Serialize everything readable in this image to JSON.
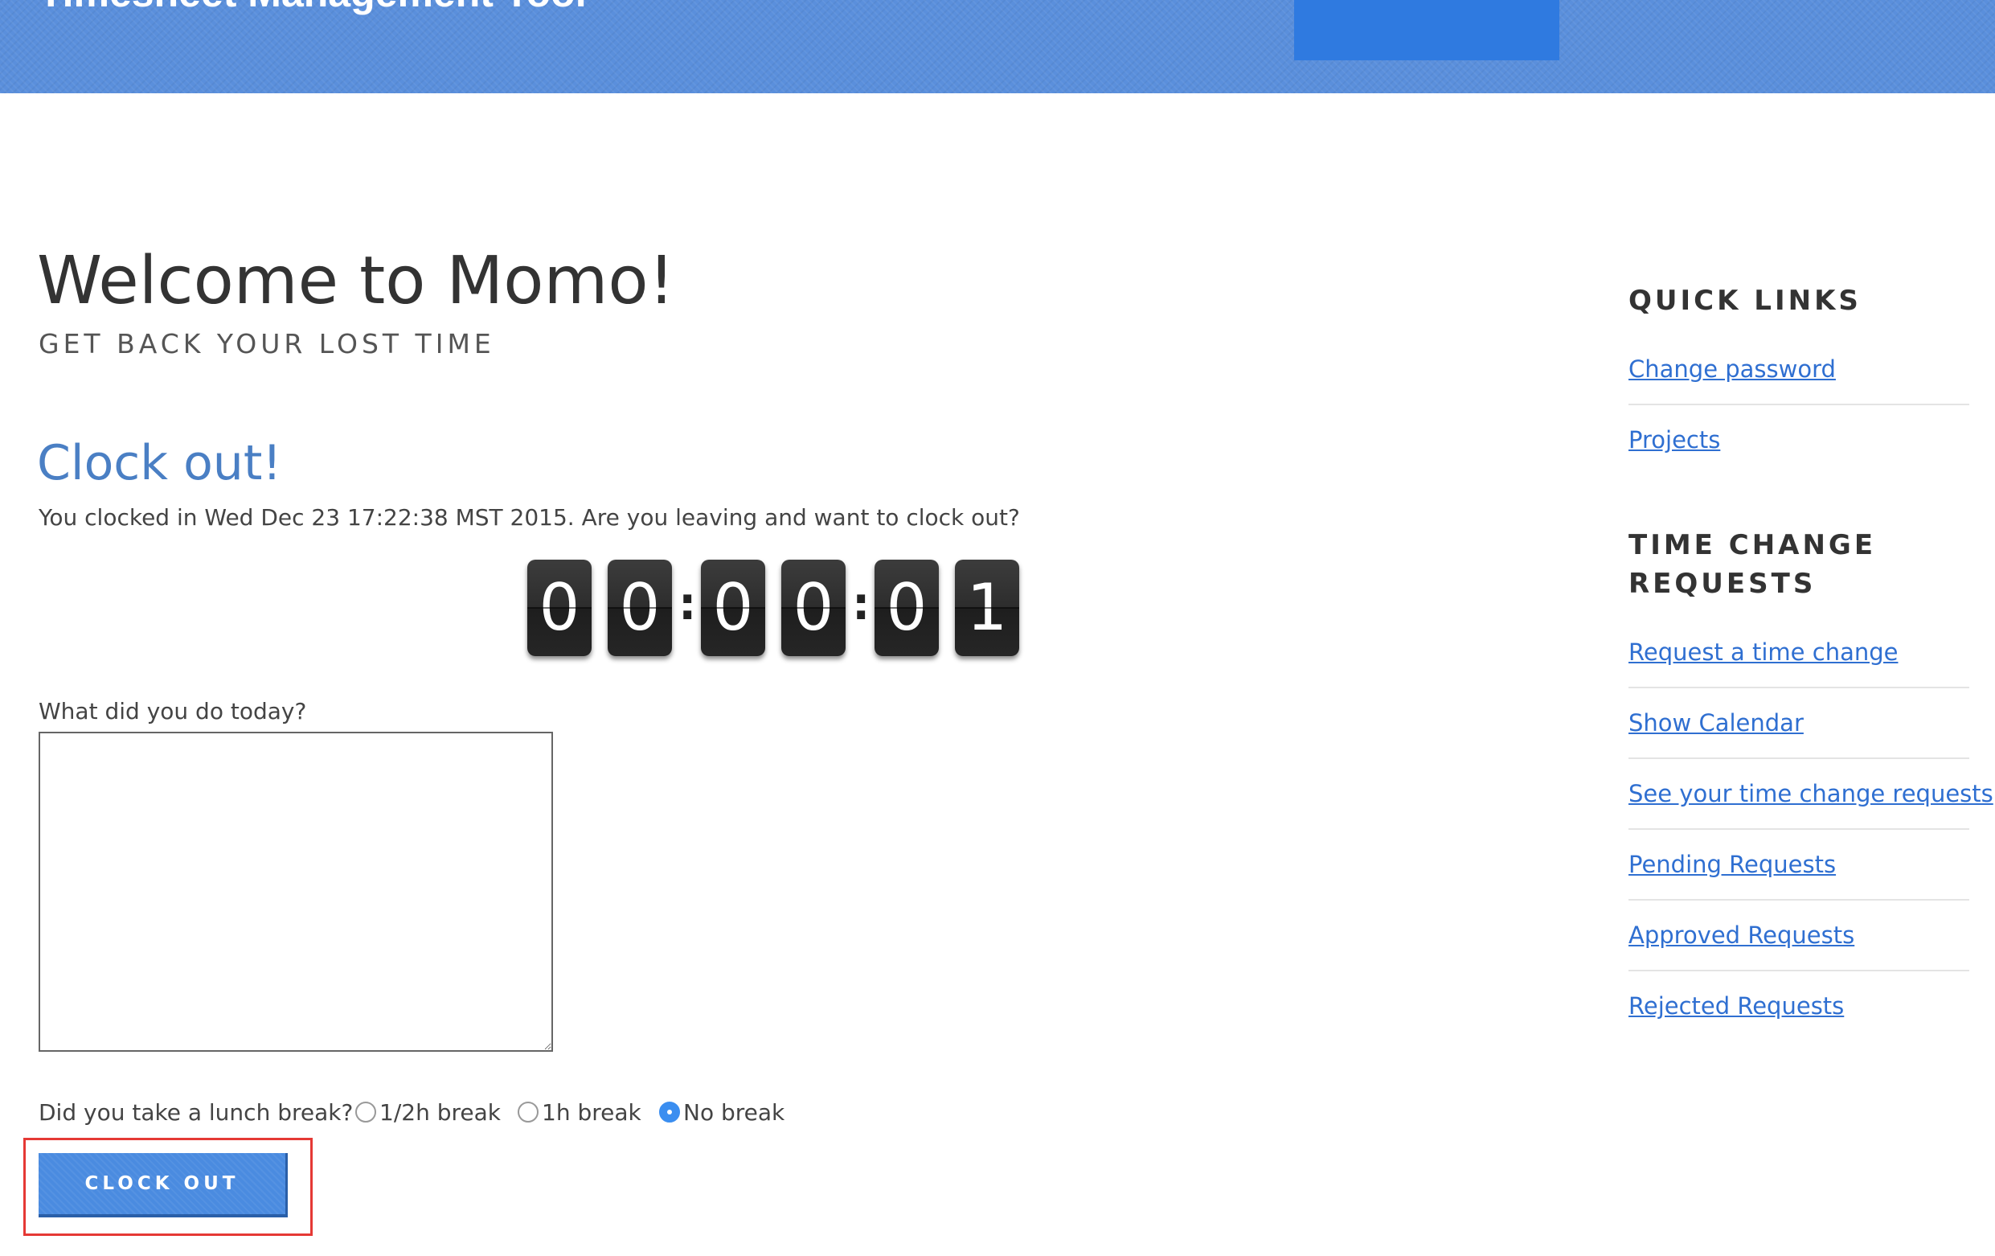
{
  "header": {
    "title": "Timesheet Management Tool"
  },
  "welcome": {
    "title": "Welcome to Momo!",
    "subtitle": "GET BACK YOUR LOST TIME"
  },
  "clock_out": {
    "title": "Clock out!",
    "description": "You clocked in Wed Dec 23 17:22:38 MST 2015. Are you leaving and want to clock out?",
    "timer": {
      "digits": [
        "0",
        "0",
        "0",
        "0",
        "0",
        "1"
      ],
      "separator": ":"
    },
    "notes_label": "What did you do today?",
    "notes_value": "",
    "lunch_label": "Did you take a lunch break?",
    "lunch_options": [
      "1/2h break",
      "1h break",
      "No break"
    ],
    "lunch_selected": "No break",
    "button_label": "CLOCK OUT"
  },
  "sidebar": {
    "quick_links_heading": "QUICK LINKS",
    "quick_links": [
      "Change password",
      "Projects"
    ],
    "time_change_heading_line1": "TIME CHANGE",
    "time_change_heading_line2": "REQUESTS",
    "time_change_links": [
      "Request a time change",
      "Show Calendar",
      "See your time change requests",
      "Pending Requests",
      "Approved Requests",
      "Rejected Requests"
    ]
  },
  "colors": {
    "header_blue": "#5a8fdc",
    "accent_blue": "#2f7ae0",
    "link_blue": "#2f6fd1",
    "title_blue": "#4a7fc4",
    "highlight_red": "#e53935"
  }
}
